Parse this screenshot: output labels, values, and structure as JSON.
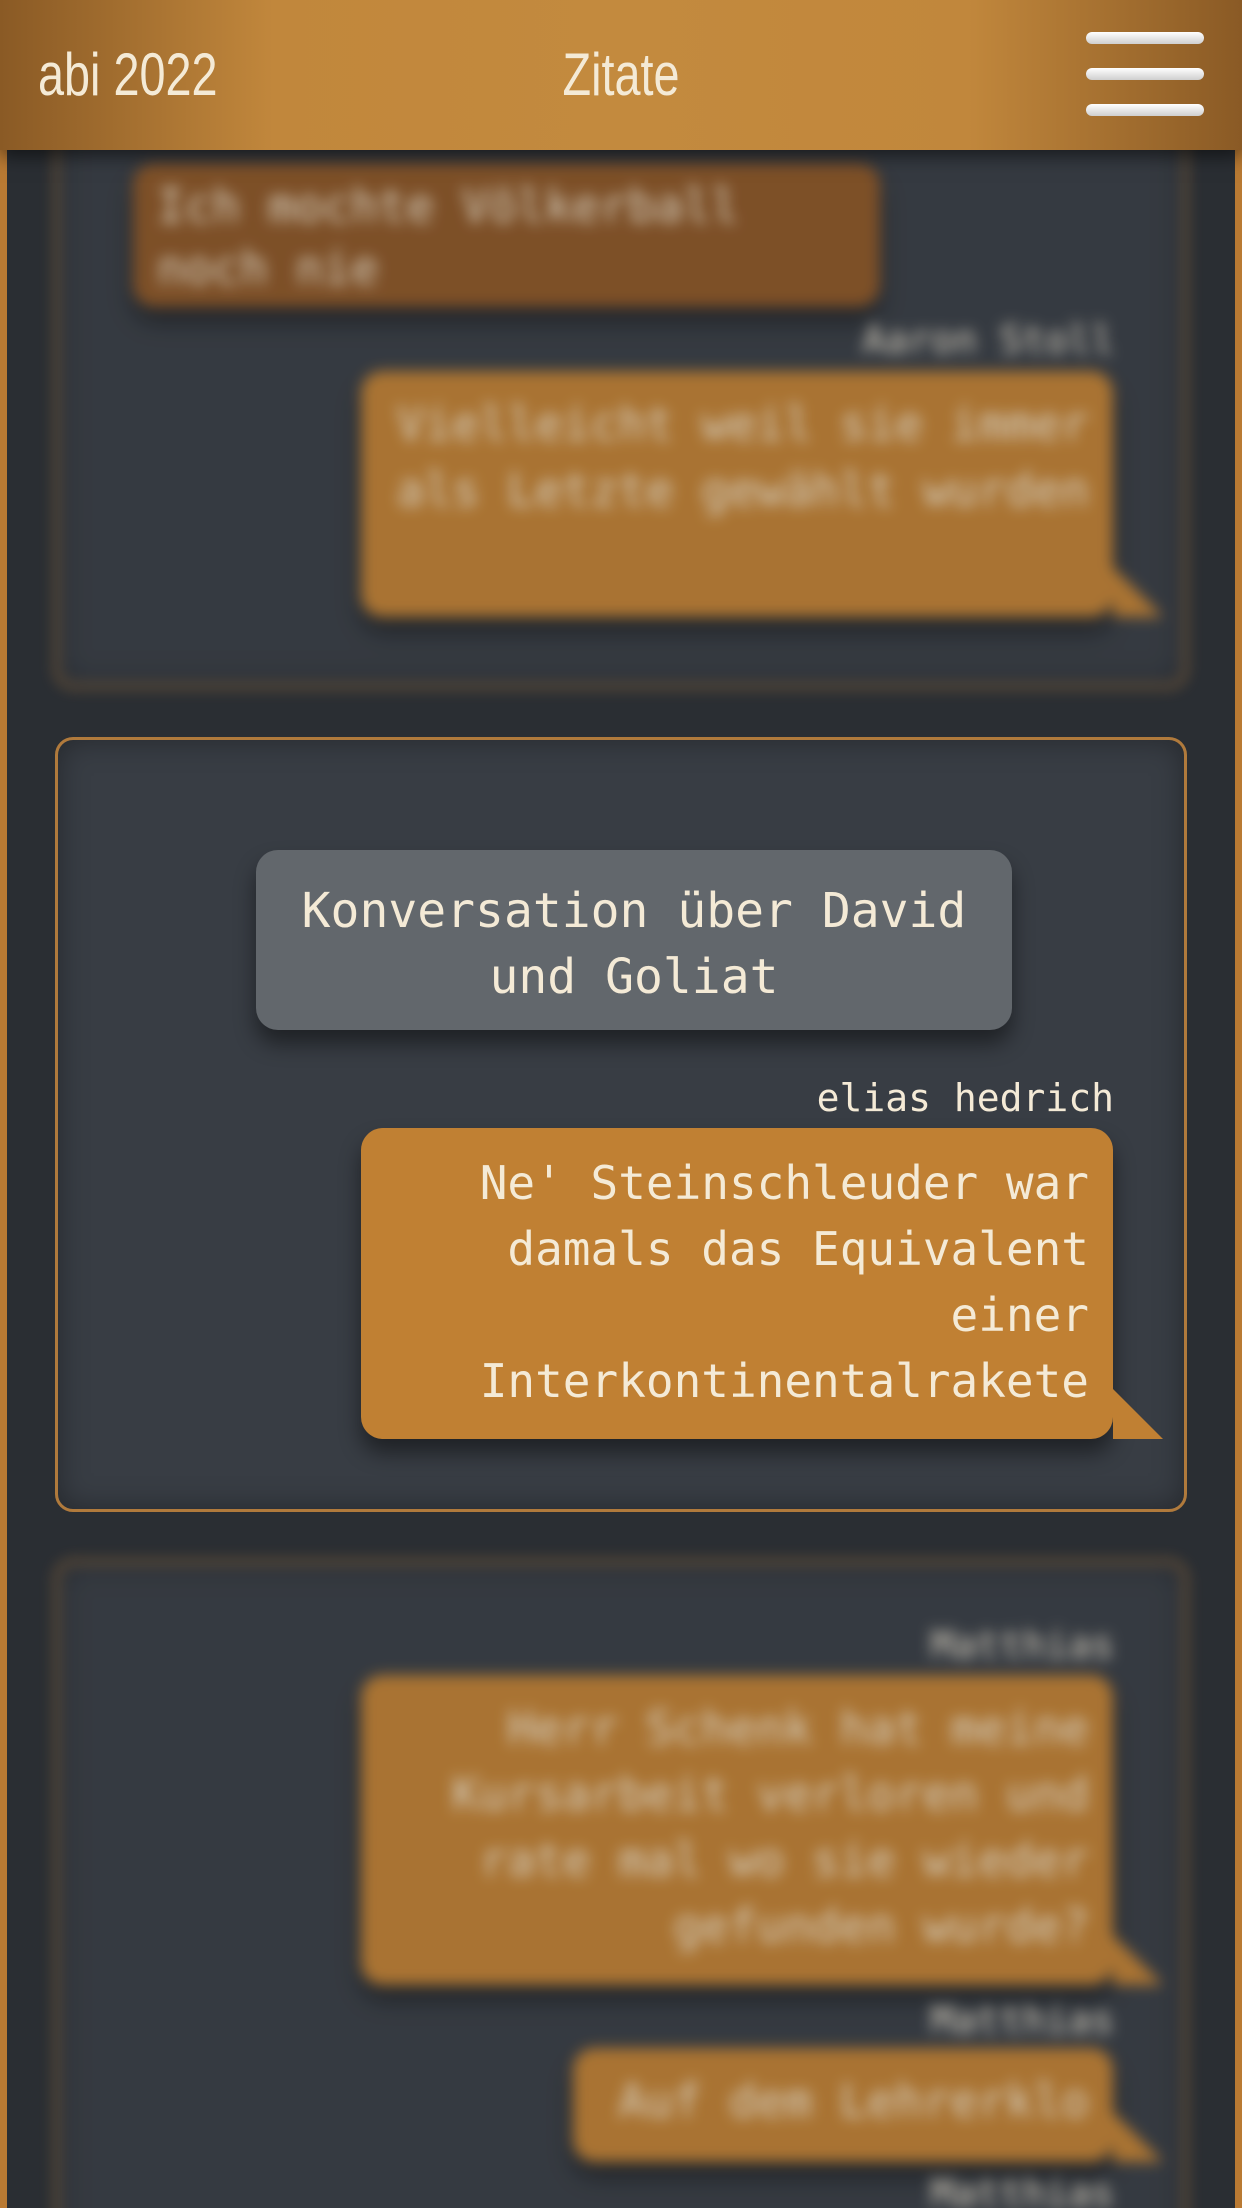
{
  "header": {
    "brand": "abi 2022",
    "title": "Zitate",
    "menu_icon": "hamburger-menu-icon"
  },
  "cards": [
    {
      "left_quote": "Ich mochte Völkerball noch nie",
      "author": "Aaron Stoll",
      "reply": "Vielleicht weil sie immer als Letzte gewählt wurden"
    },
    {
      "topic": "Konversation über David und Goliat",
      "author": "elias hedrich",
      "quote": "Ne' Steinschleuder war damals das Equivalent einer Interkontinentalrakete"
    },
    {
      "author1": "Matthias",
      "quote1": "Herr Schenk hat meine Kursarbeit verloren und rate mal wo sie wieder gefunden wurde?",
      "author2": "Matthias",
      "quote2": "Auf dem Lehrerklo",
      "author3": "Matthias"
    }
  ],
  "colors": {
    "accent": "#c08033",
    "background": "#2a2e33",
    "card": "#383d44",
    "text": "#f4ead6"
  }
}
